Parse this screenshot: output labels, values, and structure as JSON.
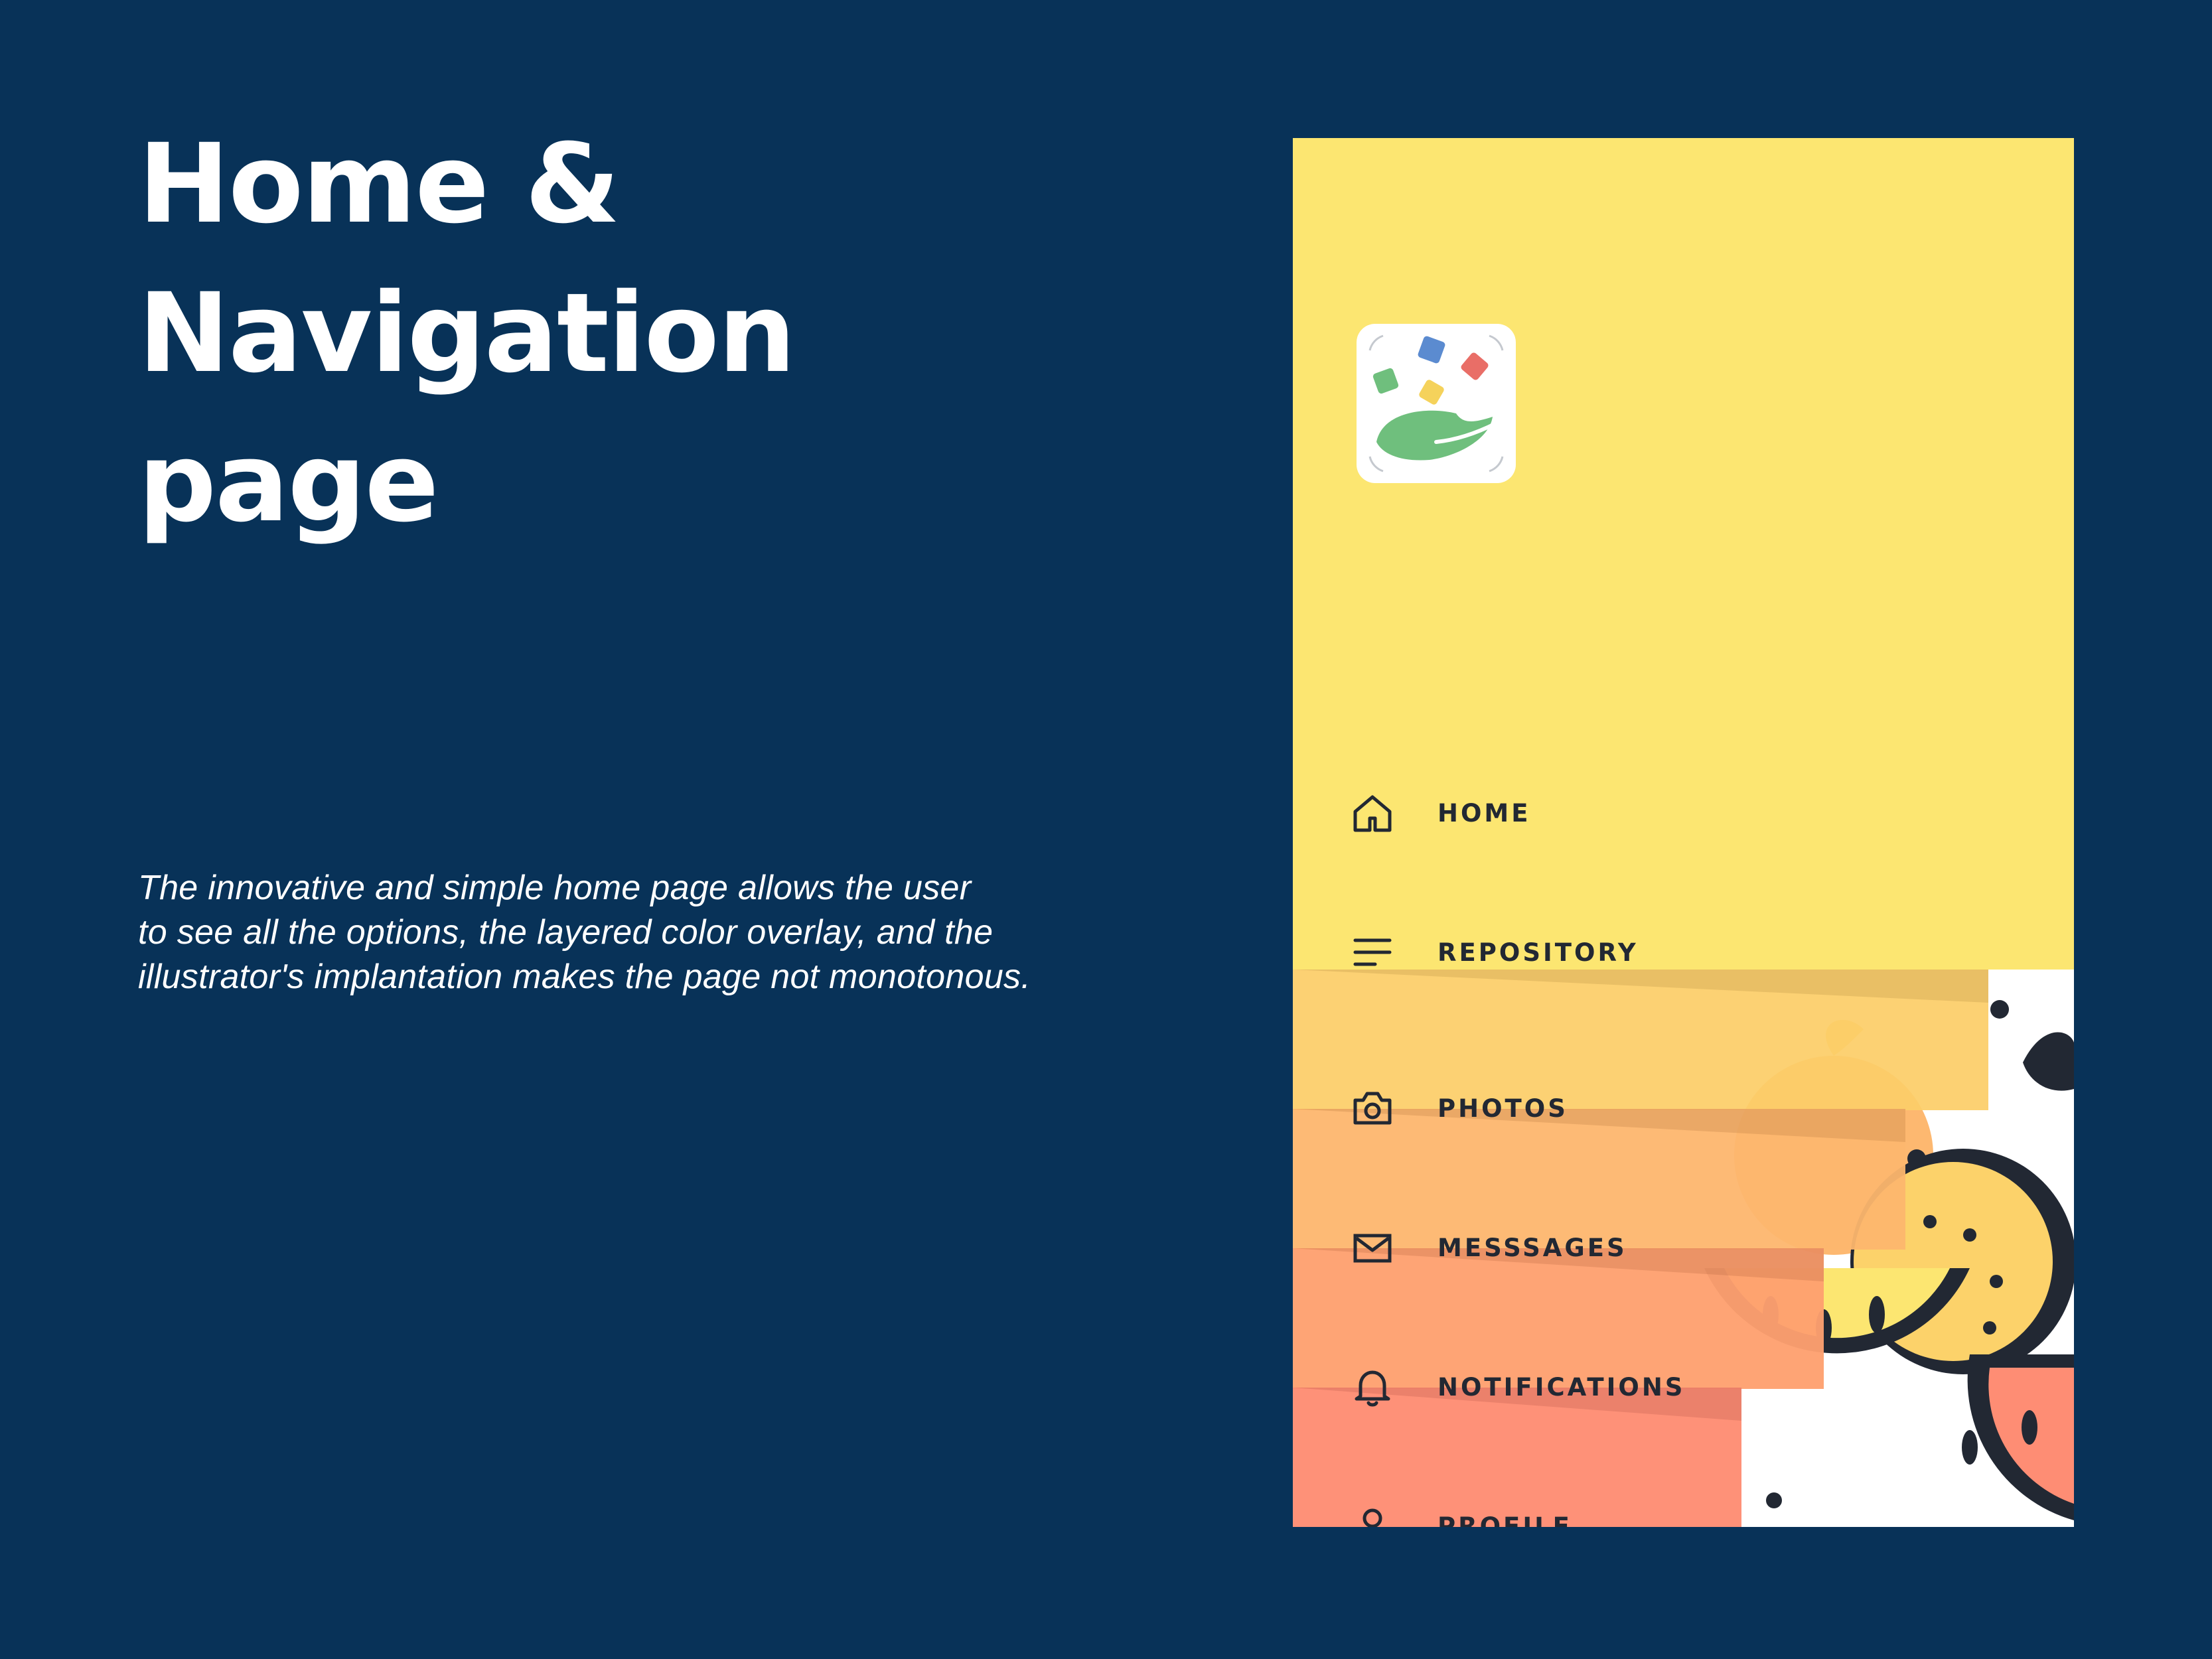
{
  "page": {
    "title_line1": "Home & Navigation",
    "title_line2": "page",
    "description_line1": "The innovative and simple home page allows the user",
    "description_line2": "to see all the options, the layered color overlay, and the",
    "description_line3": "illustrator's implantation makes the page not monotonous."
  },
  "app": {
    "logo_icon": "app-logo-leaf-confetti",
    "colors": {
      "background": "#083258",
      "drawer_yellow": "#fce671",
      "photos_band": "#fcd26a",
      "messages_band": "#fdb870",
      "notifications_band": "#fea16f",
      "profile_band": "#fe8d74",
      "text_dark": "#222833"
    },
    "nav": [
      {
        "label": "HOME",
        "icon": "home-icon"
      },
      {
        "label": "REPOSITORY",
        "icon": "menu-lines-icon"
      },
      {
        "label": "PHOTOS",
        "icon": "camera-icon"
      },
      {
        "label": "MESSSAGES",
        "icon": "mail-icon"
      },
      {
        "label": "NOTIFICATIONS",
        "icon": "bell-icon"
      },
      {
        "label": "PROFILE",
        "icon": "user-icon"
      }
    ]
  }
}
